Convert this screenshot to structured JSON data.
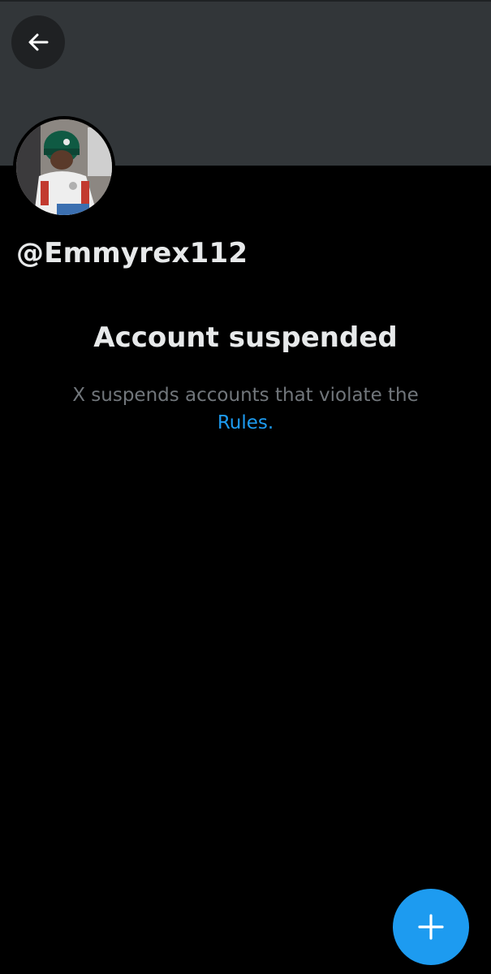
{
  "header": {
    "back_icon": "arrow-left-icon"
  },
  "profile": {
    "avatar_description": "profile-photo",
    "handle": "@Emmyrex112"
  },
  "suspension": {
    "title": "Account suspended",
    "message": "X suspends accounts that violate the",
    "link_label": "Rules."
  },
  "fab": {
    "icon": "plus-icon"
  },
  "colors": {
    "background": "#000000",
    "banner": "#323639",
    "accent": "#1d9bf0",
    "primary_text": "#e7e9ea",
    "secondary_text": "#71767b"
  }
}
